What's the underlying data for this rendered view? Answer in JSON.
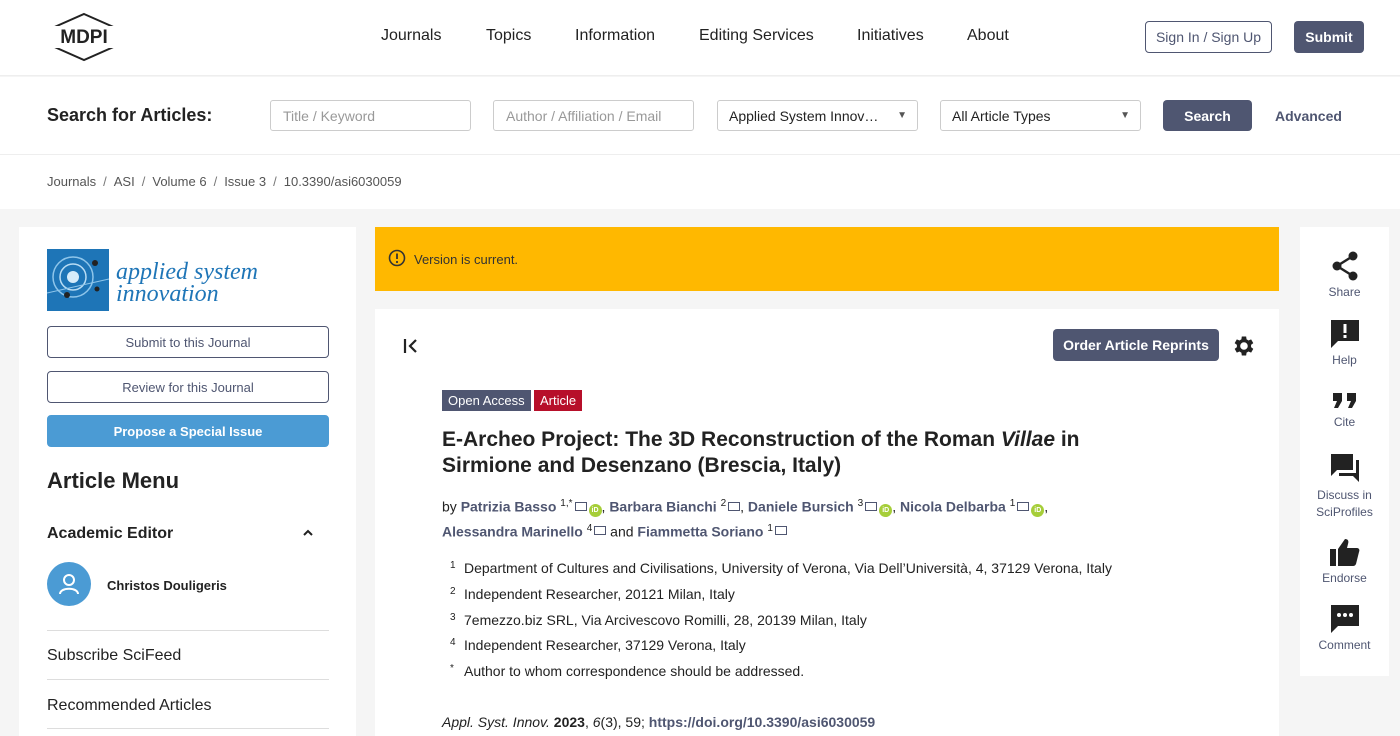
{
  "nav": {
    "logo_text": "MDPI",
    "items": [
      "Journals",
      "Topics",
      "Information",
      "Editing Services",
      "Initiatives",
      "About"
    ],
    "signin_label": "Sign In / Sign Up",
    "submit_label": "Submit"
  },
  "search": {
    "label": "Search for Articles:",
    "title_placeholder": "Title / Keyword",
    "author_placeholder": "Author / Affiliation / Email",
    "journal_selected": "Applied System Innov…",
    "type_selected": "All Article Types",
    "search_button": "Search",
    "advanced_link": "Advanced"
  },
  "breadcrumb": [
    "Journals",
    "ASI",
    "Volume 6",
    "Issue 3",
    "10.3390/asi6030059"
  ],
  "sidebar": {
    "journal_name_line1": "applied system",
    "journal_name_line2": "innovation",
    "submit_btn": "Submit to this Journal",
    "review_btn": "Review for this Journal",
    "propose_btn": "Propose a Special Issue",
    "article_menu": "Article Menu",
    "academic_editor_heading": "Academic Editor",
    "editor_name": "Christos Douligeris",
    "links": [
      "Subscribe SciFeed",
      "Recommended Articles"
    ]
  },
  "banner": {
    "text": "Version is current."
  },
  "article": {
    "reprints_btn": "Order Article Reprints",
    "badge_open_access": "Open Access",
    "badge_type": "Article",
    "title_part1": "E-Archeo Project: The 3D Reconstruction of the Roman ",
    "title_italic": "Villae",
    "title_part2": " in Sirmione and Desenzano (Brescia, Italy)",
    "by": "by",
    "and": "and",
    "authors": [
      {
        "name": "Patrizia Basso",
        "sup": "1,*",
        "orcid": true
      },
      {
        "name": "Barbara Bianchi",
        "sup": "2",
        "orcid": false
      },
      {
        "name": "Daniele Bursich",
        "sup": "3",
        "orcid": true
      },
      {
        "name": "Nicola Delbarba",
        "sup": "1",
        "orcid": true
      },
      {
        "name": "Alessandra Marinello",
        "sup": "4",
        "orcid": false
      },
      {
        "name": "Fiammetta Soriano",
        "sup": "1",
        "orcid": false
      }
    ],
    "affiliations": [
      {
        "n": "1",
        "text": "Department of Cultures and Civilisations, University of Verona, Via Dell’Università, 4, 37129 Verona, Italy"
      },
      {
        "n": "2",
        "text": "Independent Researcher, 20121 Milan, Italy"
      },
      {
        "n": "3",
        "text": "7emezzo.biz SRL, Via Arcivescovo Romilli, 28, 20139 Milan, Italy"
      },
      {
        "n": "4",
        "text": "Independent Researcher, 37129 Verona, Italy"
      },
      {
        "n": "*",
        "text": "Author to whom correspondence should be addressed."
      }
    ],
    "citation": {
      "journal": "Appl. Syst. Innov.",
      "year": "2023",
      "volume": "6",
      "issue_page": "(3), 59;",
      "doi": "https://doi.org/10.3390/asi6030059"
    }
  },
  "rail": [
    "Share",
    "Help",
    "Cite",
    "Discuss in SciProfiles",
    "Endorse",
    "Comment"
  ],
  "colors": {
    "primary": "#4f5671",
    "banner": "#ffb800",
    "article_badge": "#b70f2a",
    "accent_blue": "#4b9bd4",
    "orcid": "#a6ce39"
  }
}
